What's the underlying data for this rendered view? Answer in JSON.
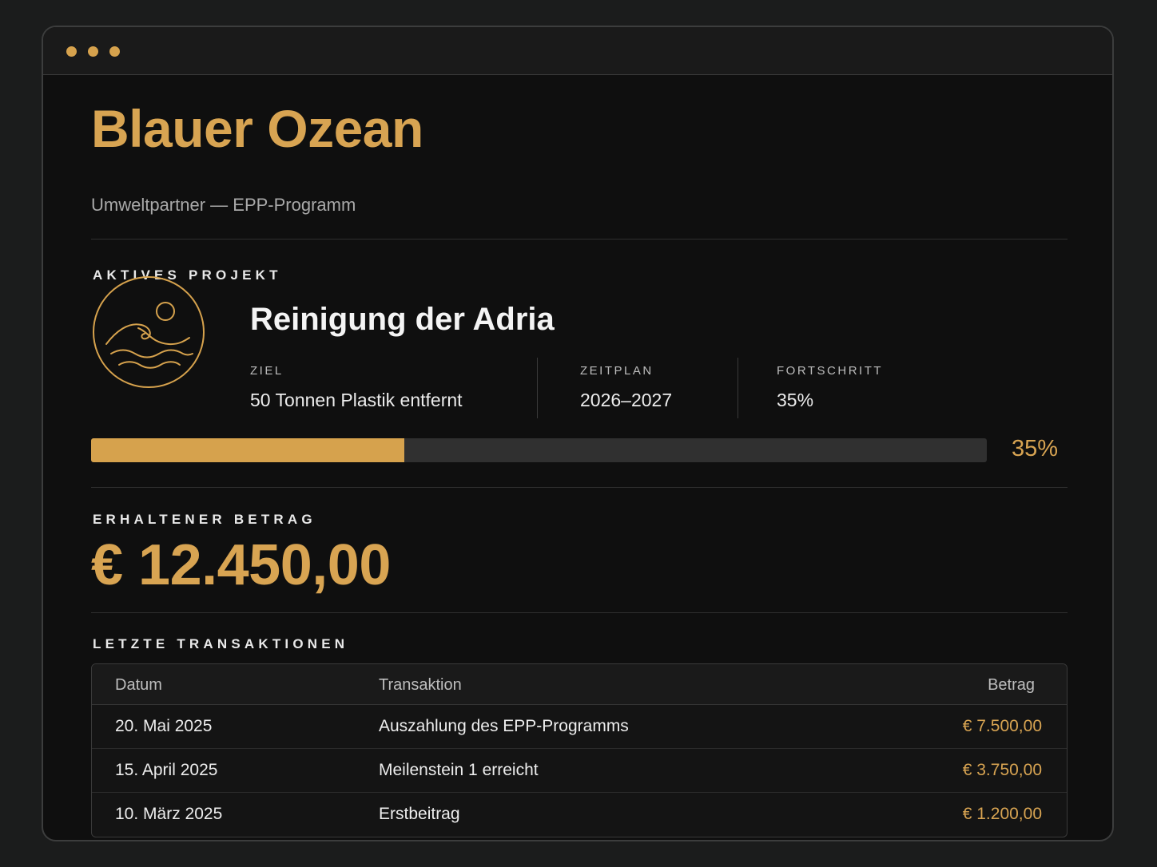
{
  "window": {
    "controls": [
      "dot",
      "dot",
      "dot"
    ],
    "accent_color": "#d6a24d",
    "background_color": "#0f0f0f"
  },
  "header": {
    "title": "Blauer Ozean",
    "subtitle": "Umweltpartner — EPP-Programm"
  },
  "project": {
    "section_label": "AKTIVES PROJEKT",
    "icon": "ocean-wave-icon",
    "name": "Reinigung der Adria",
    "stats": [
      {
        "label": "ZIEL",
        "value": "50 Tonnen Plastik entfernt"
      },
      {
        "label": "ZEITPLAN",
        "value": "2026–2027"
      },
      {
        "label": "FORTSCHRITT",
        "value": "35%"
      }
    ],
    "progress": {
      "fraction": 0.35,
      "label": "35%"
    }
  },
  "funds": {
    "section_label": "ERHALTENER BETRAG",
    "amount": "€ 12.450,00"
  },
  "transactions": {
    "section_label": "LETZTE TRANSAKTIONEN",
    "columns": [
      "Datum",
      "Transaktion",
      "Betrag"
    ],
    "rows": [
      {
        "date": "20. Mai 2025",
        "description": "Auszahlung des EPP-Programms",
        "amount": "€ 7.500,00"
      },
      {
        "date": "15. April 2025",
        "description": "Meilenstein 1 erreicht",
        "amount": "€ 3.750,00"
      },
      {
        "date": "10. März 2025",
        "description": "Erstbeitrag",
        "amount": "€ 1.200,00"
      }
    ]
  }
}
